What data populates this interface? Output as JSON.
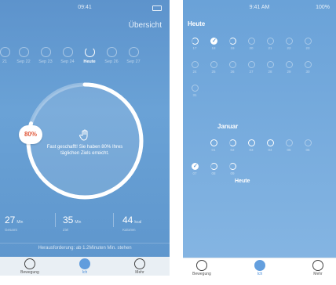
{
  "left": {
    "status_time": "09:41",
    "overview_label": "Übersicht",
    "days": [
      {
        "label": "21",
        "today": false
      },
      {
        "label": "Sep 22",
        "today": false
      },
      {
        "label": "Sep 23",
        "today": false
      },
      {
        "label": "Sep 24",
        "today": false
      },
      {
        "label": "Heute",
        "today": true
      },
      {
        "label": "Sep 26",
        "today": false
      },
      {
        "label": "Sep 27",
        "today": false
      }
    ],
    "progress_fraction": 0.8,
    "percent_badge": "80%",
    "ring_message": "Fast geschafft! Sie haben 80% Ihres täglichen Ziels erreicht.",
    "stats": [
      {
        "value": "27",
        "unit": "Min",
        "label": "Gesamt"
      },
      {
        "value": "35",
        "unit": "Min",
        "label": "Ziel"
      },
      {
        "value": "44",
        "unit": "kcal",
        "label": "Kalorien"
      }
    ],
    "hint": "Herausforderung: ab 1.2Minuten Min. stehen",
    "tabs": [
      {
        "label": "Bewegung",
        "icon": "clock-icon",
        "active": false
      },
      {
        "label": "Ich",
        "icon": "profile-icon",
        "active": true
      },
      {
        "label": "Mehr",
        "icon": "gear-icon",
        "active": false
      }
    ]
  },
  "right": {
    "status_time": "9:41 AM",
    "status_battery": "100%",
    "month1_label": "Heute",
    "month2_label": "Januar",
    "today_label": "Heute",
    "month1_days": [
      {
        "d": "17",
        "s": "half"
      },
      {
        "d": "18",
        "s": "full"
      },
      {
        "d": "19",
        "s": "half"
      },
      {
        "d": "20",
        "s": "empty"
      },
      {
        "d": "21",
        "s": "empty"
      },
      {
        "d": "22",
        "s": "empty"
      },
      {
        "d": "23",
        "s": "empty"
      },
      {
        "d": "24",
        "s": "empty"
      },
      {
        "d": "25",
        "s": "empty"
      },
      {
        "d": "26",
        "s": "empty"
      },
      {
        "d": "27",
        "s": "empty"
      },
      {
        "d": "28",
        "s": "empty"
      },
      {
        "d": "29",
        "s": "empty"
      },
      {
        "d": "30",
        "s": "empty"
      },
      {
        "d": "31",
        "s": "empty"
      }
    ],
    "month2_days": [
      {
        "d": "01",
        "s": "ring"
      },
      {
        "d": "02",
        "s": "half"
      },
      {
        "d": "03",
        "s": "ring"
      },
      {
        "d": "04",
        "s": "ring"
      },
      {
        "d": "05",
        "s": "empty"
      },
      {
        "d": "06",
        "s": "empty"
      },
      {
        "d": "07",
        "s": "full"
      },
      {
        "d": "08",
        "s": "half"
      },
      {
        "d": "09",
        "s": "half"
      }
    ],
    "tabs": [
      {
        "label": "Bewegung",
        "icon": "clock-icon",
        "active": false
      },
      {
        "label": "Ich",
        "icon": "profile-icon",
        "active": true
      },
      {
        "label": "Mehr",
        "icon": "more-icon",
        "active": false
      }
    ]
  }
}
